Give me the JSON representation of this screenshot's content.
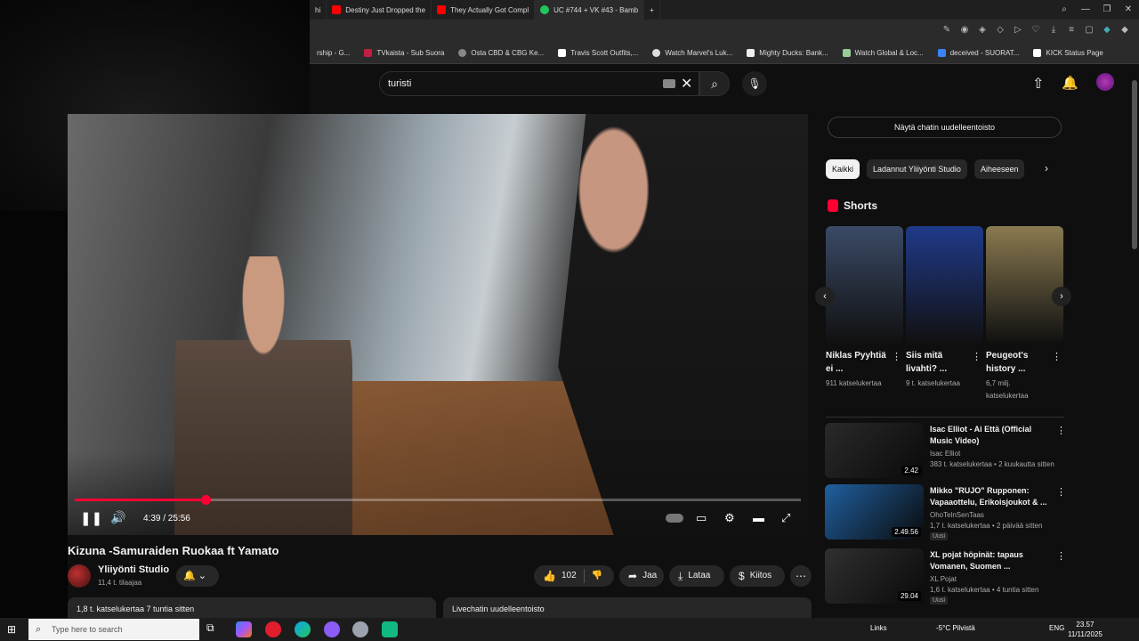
{
  "browser": {
    "tabs": [
      {
        "label": "hi"
      },
      {
        "label": "Destiny Just Dropped the"
      },
      {
        "label": "They Actually Got Compl"
      },
      {
        "label": "UC #744 + VK #43 - Bamb"
      }
    ],
    "new_tab": "+",
    "bookmarks": [
      "rship - G...",
      "TVkaista - Sub Suora",
      "Osta CBD & CBG Ke...",
      "Travis Scott Outfits,...",
      "Watch Marvel's Luk...",
      "Mighty Ducks: Bank...",
      "Watch Global & Loc...",
      "deceived - SUORAT...",
      "KICK Status Page"
    ]
  },
  "header": {
    "search_value": "turisti"
  },
  "player": {
    "time": "4:39 / 25:56",
    "progress": 0.18
  },
  "video": {
    "title": "Kizuna -Samuraiden Ruokaa ft Yamato",
    "channel_name": "Yliiyönti Studio",
    "channel_subs": "11,4 t. tilaajaa",
    "likes": "102",
    "share_label": "Jaa",
    "download_label": "Lataa",
    "thanks_label": "Kiitos",
    "description_meta": "1,8 t. katselukertaa  7 tuntia sitten",
    "chat_replay_label": "Livechatin uudelleentoisto"
  },
  "sidebar": {
    "chat_replay_button": "Näytä chatin uudelleentoisto",
    "chips": [
      "Kaikki",
      "Ladannut Yliiyönti Studio",
      "Aiheeseen"
    ],
    "shorts_title": "Shorts",
    "shorts": [
      {
        "title": "Niklas Pyyhtiä ei ...",
        "views": "911 katselukertaa",
        "color": "#3a4a66"
      },
      {
        "title": "Siis mitä livahti? ...",
        "views": "9 t. katselukertaa",
        "color": "#1f3a8a"
      },
      {
        "title": "Peugeot's history ...",
        "views": "6,7 milj. katselukertaa",
        "color": "#8a7a50"
      }
    ],
    "recommendations": [
      {
        "title": "Isac Elliot - Ai Että (Official Music Video)",
        "channel": "Isac Elliot",
        "meta": "383 t. katselukertaa • 2 kuukautta sitten",
        "duration": "2.42",
        "new": "",
        "color": "#2a2a2a"
      },
      {
        "title": "Mikko \"RUJO\" Rupponen: Vapaaottelu, Erikoisjoukot & ...",
        "channel": "OhoTelnSenTaas",
        "meta": "1,7 t. katselukertaa • 2 päivää sitten",
        "duration": "2.49.56",
        "new": "Uusi",
        "color": "#2060a0"
      },
      {
        "title": "XL pojat höpinät: tapaus Vomanen, Suomen ...",
        "channel": "XL Pojat",
        "meta": "1,6 t. katselukertaa • 4 tuntia sitten",
        "duration": "29.04",
        "new": "Uusi",
        "color": "#303030"
      }
    ]
  },
  "taskbar": {
    "search_placeholder": "Type here to search",
    "links": "Links",
    "weather": "-5°C Pilvistä",
    "lang": "ENG",
    "time": "23.57",
    "date": "11/11/2025"
  }
}
